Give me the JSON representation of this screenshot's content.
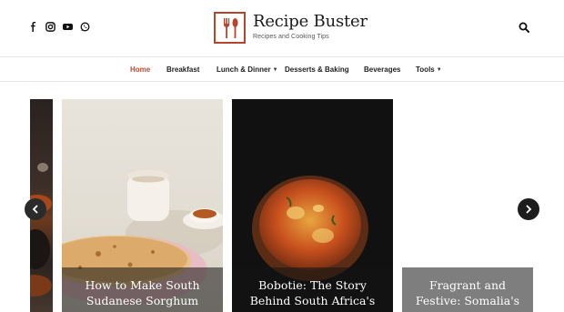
{
  "brand": {
    "title": "Recipe Buster",
    "tagline": "Recipes and Cooking Tips",
    "accent": "#b5452b"
  },
  "socials": [
    {
      "icon": "facebook-icon"
    },
    {
      "icon": "instagram-icon"
    },
    {
      "icon": "youtube-icon"
    },
    {
      "icon": "whatsapp-icon"
    }
  ],
  "nav": {
    "items": [
      {
        "label": "Home",
        "active": true
      },
      {
        "label": "Breakfast"
      },
      {
        "label": "Lunch & Dinner",
        "dropdown": true
      },
      {
        "label": "Desserts & Baking"
      },
      {
        "label": "Beverages"
      },
      {
        "label": "Tools",
        "dropdown": true
      }
    ],
    "active_color": "#c24a2c"
  },
  "slider": {
    "cards": [
      {
        "title": ""
      },
      {
        "title": "How to Make South Sudanese Sorghum Bread"
      },
      {
        "title": "Bobotie: The Story Behind South Africa's Sweet-Meat Comfort"
      },
      {
        "title": "Fragrant and Festive: Somalia's Bariis Iskukaris"
      }
    ]
  }
}
